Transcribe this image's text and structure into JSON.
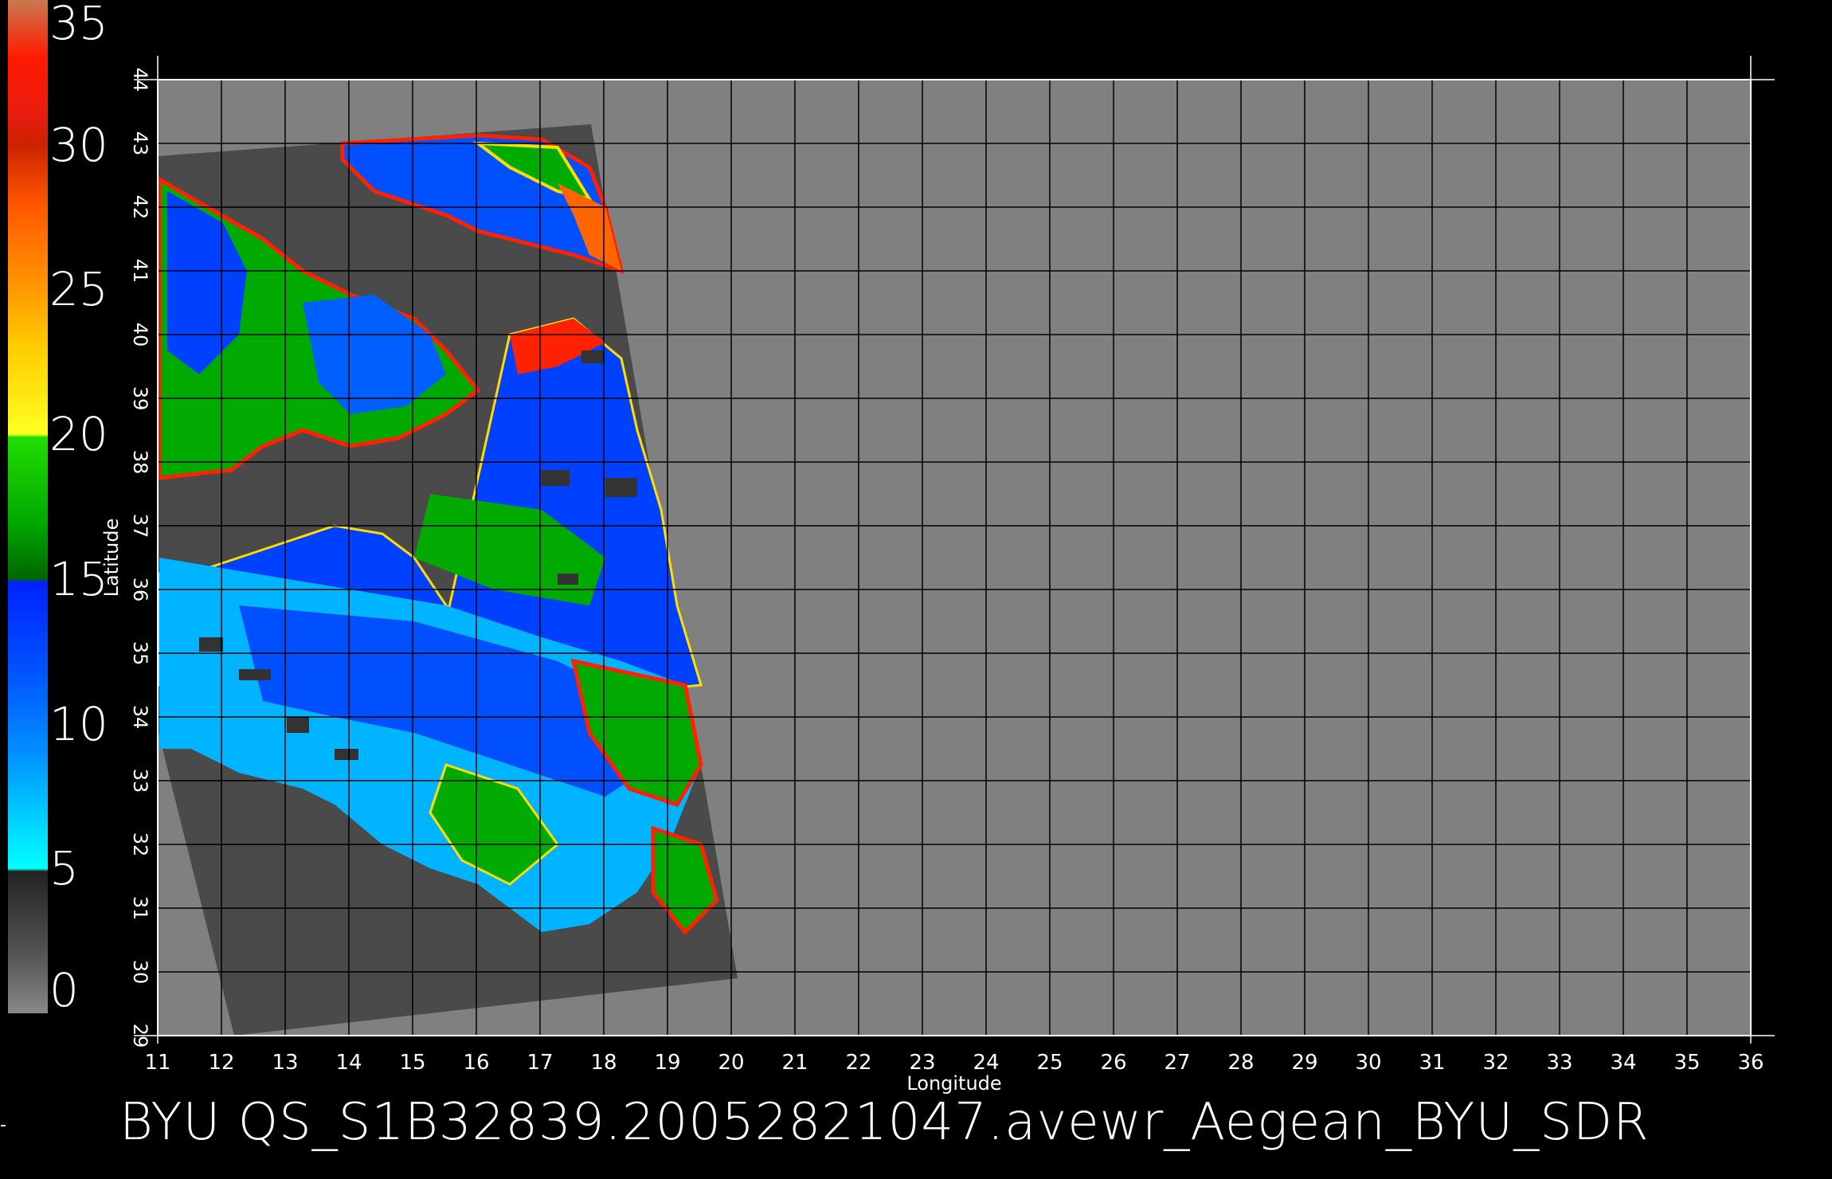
{
  "colorbar": {
    "labels": [
      "35",
      "30",
      "25",
      "20",
      "15",
      "10",
      "5",
      "0"
    ],
    "stops": [
      {
        "value": 35,
        "color": "#c8794f"
      },
      {
        "value": 33,
        "color": "#ff1a00"
      },
      {
        "value": 31,
        "color": "#e81c10"
      },
      {
        "value": 30,
        "color": "#cc2200"
      },
      {
        "value": 28,
        "color": "#ff5500"
      },
      {
        "value": 25,
        "color": "#ff9900"
      },
      {
        "value": 23,
        "color": "#ffcc00"
      },
      {
        "value": 20,
        "color": "#ffff22"
      },
      {
        "value": 19.9,
        "color": "#22dd00"
      },
      {
        "value": 17,
        "color": "#00aa00"
      },
      {
        "value": 15,
        "color": "#006600"
      },
      {
        "value": 14.9,
        "color": "#0022ff"
      },
      {
        "value": 12,
        "color": "#0050ff"
      },
      {
        "value": 9,
        "color": "#0090ff"
      },
      {
        "value": 5,
        "color": "#00ffff"
      },
      {
        "value": 4.9,
        "color": "#222222"
      },
      {
        "value": 2,
        "color": "#555555"
      },
      {
        "value": 0,
        "color": "#888888"
      }
    ]
  },
  "map": {
    "xlabel": "Longitude",
    "ylabel": "Latitude",
    "lon_ticks": [
      "11",
      "12",
      "13",
      "14",
      "15",
      "16",
      "17",
      "18",
      "19",
      "20",
      "21",
      "22",
      "23",
      "24",
      "25",
      "26",
      "27",
      "28",
      "29",
      "30",
      "31",
      "32",
      "33",
      "34",
      "35",
      "36"
    ],
    "lat_ticks": [
      "29",
      "30",
      "31",
      "32",
      "33",
      "34",
      "35",
      "36",
      "37",
      "38",
      "39",
      "40",
      "41",
      "42",
      "43",
      "44"
    ],
    "xlim": [
      11,
      36
    ],
    "ylim": [
      29,
      44
    ],
    "grid": true,
    "background_color": "#808080",
    "swath_color": "#4a4a4a",
    "swath_corners_lonlat": [
      [
        11.0,
        42.8
      ],
      [
        17.8,
        43.3
      ],
      [
        20.1,
        29.9
      ],
      [
        12.2,
        29.0
      ],
      [
        11.0,
        33.8
      ]
    ]
  },
  "caption": "BYU  QS_S1B32839.20052821047.avewr_Aegean_BYU_SDR",
  "left_marker": "-"
}
